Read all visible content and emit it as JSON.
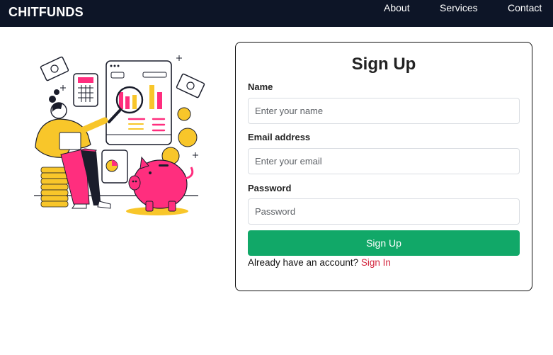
{
  "navbar": {
    "brand": "CHITFUNDS",
    "links": [
      {
        "label": "About"
      },
      {
        "label": "Services"
      },
      {
        "label": "Contact"
      }
    ]
  },
  "illustration": {
    "icon": "finance-illustration",
    "colors": {
      "pink": "#ff2e7e",
      "yellow": "#f8c62a",
      "dark": "#1a1d2b"
    }
  },
  "form": {
    "title": "Sign Up",
    "fields": {
      "name": {
        "label": "Name",
        "placeholder": "Enter your name",
        "value": ""
      },
      "email": {
        "label": "Email address",
        "placeholder": "Enter your email",
        "value": ""
      },
      "password": {
        "label": "Password",
        "placeholder": "Password",
        "value": ""
      }
    },
    "submit_label": "Sign Up",
    "footer_text": "Already have an account?",
    "footer_link": "Sign In"
  },
  "colors": {
    "navbar_bg": "#0d1527",
    "button_bg": "#11a868",
    "link": "#d3263e"
  }
}
